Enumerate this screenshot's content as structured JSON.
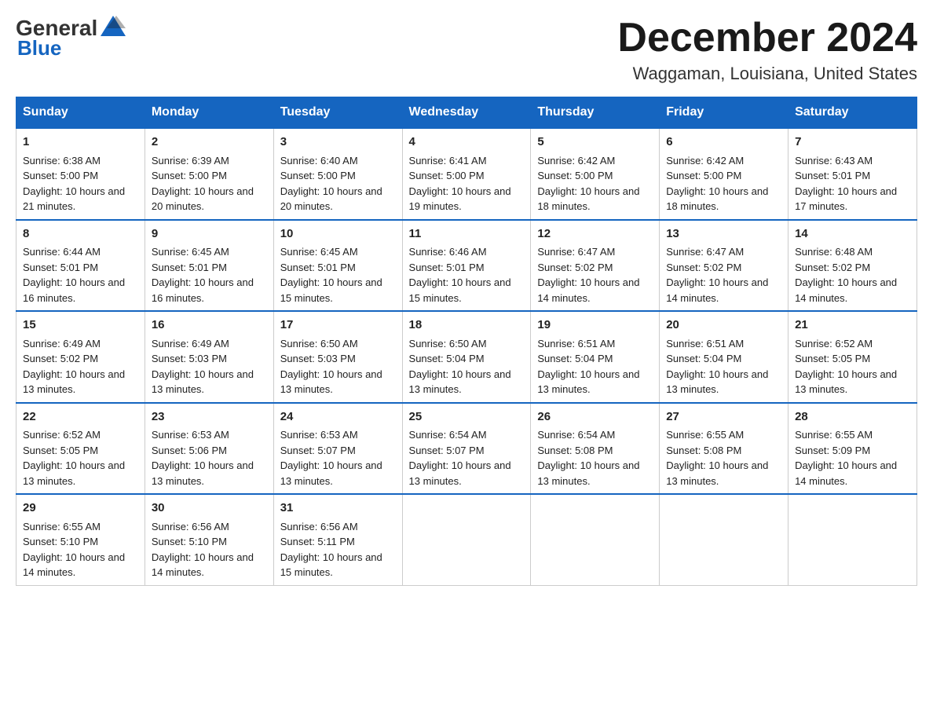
{
  "header": {
    "logo_general": "General",
    "logo_blue": "Blue",
    "title": "December 2024",
    "subtitle": "Waggaman, Louisiana, United States"
  },
  "days": [
    "Sunday",
    "Monday",
    "Tuesday",
    "Wednesday",
    "Thursday",
    "Friday",
    "Saturday"
  ],
  "weeks": [
    [
      {
        "day": "1",
        "sunrise": "6:38 AM",
        "sunset": "5:00 PM",
        "daylight": "10 hours and 21 minutes."
      },
      {
        "day": "2",
        "sunrise": "6:39 AM",
        "sunset": "5:00 PM",
        "daylight": "10 hours and 20 minutes."
      },
      {
        "day": "3",
        "sunrise": "6:40 AM",
        "sunset": "5:00 PM",
        "daylight": "10 hours and 20 minutes."
      },
      {
        "day": "4",
        "sunrise": "6:41 AM",
        "sunset": "5:00 PM",
        "daylight": "10 hours and 19 minutes."
      },
      {
        "day": "5",
        "sunrise": "6:42 AM",
        "sunset": "5:00 PM",
        "daylight": "10 hours and 18 minutes."
      },
      {
        "day": "6",
        "sunrise": "6:42 AM",
        "sunset": "5:00 PM",
        "daylight": "10 hours and 18 minutes."
      },
      {
        "day": "7",
        "sunrise": "6:43 AM",
        "sunset": "5:01 PM",
        "daylight": "10 hours and 17 minutes."
      }
    ],
    [
      {
        "day": "8",
        "sunrise": "6:44 AM",
        "sunset": "5:01 PM",
        "daylight": "10 hours and 16 minutes."
      },
      {
        "day": "9",
        "sunrise": "6:45 AM",
        "sunset": "5:01 PM",
        "daylight": "10 hours and 16 minutes."
      },
      {
        "day": "10",
        "sunrise": "6:45 AM",
        "sunset": "5:01 PM",
        "daylight": "10 hours and 15 minutes."
      },
      {
        "day": "11",
        "sunrise": "6:46 AM",
        "sunset": "5:01 PM",
        "daylight": "10 hours and 15 minutes."
      },
      {
        "day": "12",
        "sunrise": "6:47 AM",
        "sunset": "5:02 PM",
        "daylight": "10 hours and 14 minutes."
      },
      {
        "day": "13",
        "sunrise": "6:47 AM",
        "sunset": "5:02 PM",
        "daylight": "10 hours and 14 minutes."
      },
      {
        "day": "14",
        "sunrise": "6:48 AM",
        "sunset": "5:02 PM",
        "daylight": "10 hours and 14 minutes."
      }
    ],
    [
      {
        "day": "15",
        "sunrise": "6:49 AM",
        "sunset": "5:02 PM",
        "daylight": "10 hours and 13 minutes."
      },
      {
        "day": "16",
        "sunrise": "6:49 AM",
        "sunset": "5:03 PM",
        "daylight": "10 hours and 13 minutes."
      },
      {
        "day": "17",
        "sunrise": "6:50 AM",
        "sunset": "5:03 PM",
        "daylight": "10 hours and 13 minutes."
      },
      {
        "day": "18",
        "sunrise": "6:50 AM",
        "sunset": "5:04 PM",
        "daylight": "10 hours and 13 minutes."
      },
      {
        "day": "19",
        "sunrise": "6:51 AM",
        "sunset": "5:04 PM",
        "daylight": "10 hours and 13 minutes."
      },
      {
        "day": "20",
        "sunrise": "6:51 AM",
        "sunset": "5:04 PM",
        "daylight": "10 hours and 13 minutes."
      },
      {
        "day": "21",
        "sunrise": "6:52 AM",
        "sunset": "5:05 PM",
        "daylight": "10 hours and 13 minutes."
      }
    ],
    [
      {
        "day": "22",
        "sunrise": "6:52 AM",
        "sunset": "5:05 PM",
        "daylight": "10 hours and 13 minutes."
      },
      {
        "day": "23",
        "sunrise": "6:53 AM",
        "sunset": "5:06 PM",
        "daylight": "10 hours and 13 minutes."
      },
      {
        "day": "24",
        "sunrise": "6:53 AM",
        "sunset": "5:07 PM",
        "daylight": "10 hours and 13 minutes."
      },
      {
        "day": "25",
        "sunrise": "6:54 AM",
        "sunset": "5:07 PM",
        "daylight": "10 hours and 13 minutes."
      },
      {
        "day": "26",
        "sunrise": "6:54 AM",
        "sunset": "5:08 PM",
        "daylight": "10 hours and 13 minutes."
      },
      {
        "day": "27",
        "sunrise": "6:55 AM",
        "sunset": "5:08 PM",
        "daylight": "10 hours and 13 minutes."
      },
      {
        "day": "28",
        "sunrise": "6:55 AM",
        "sunset": "5:09 PM",
        "daylight": "10 hours and 14 minutes."
      }
    ],
    [
      {
        "day": "29",
        "sunrise": "6:55 AM",
        "sunset": "5:10 PM",
        "daylight": "10 hours and 14 minutes."
      },
      {
        "day": "30",
        "sunrise": "6:56 AM",
        "sunset": "5:10 PM",
        "daylight": "10 hours and 14 minutes."
      },
      {
        "day": "31",
        "sunrise": "6:56 AM",
        "sunset": "5:11 PM",
        "daylight": "10 hours and 15 minutes."
      },
      null,
      null,
      null,
      null
    ]
  ],
  "labels": {
    "sunrise": "Sunrise:",
    "sunset": "Sunset:",
    "daylight": "Daylight:"
  }
}
